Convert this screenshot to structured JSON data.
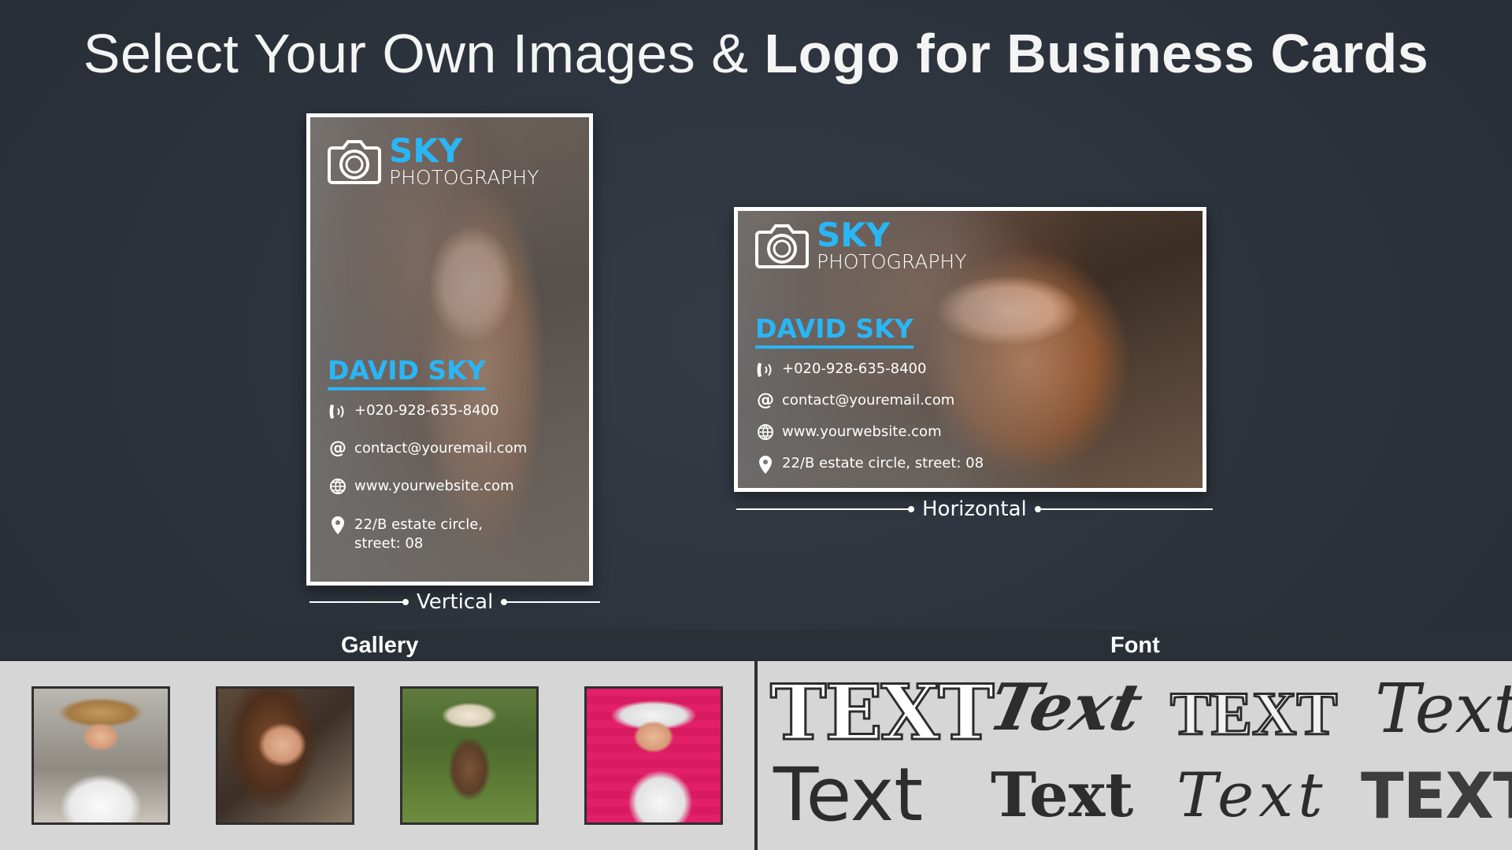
{
  "headline": {
    "light": "Select Your Own Images & ",
    "bold": "Logo for Business Cards"
  },
  "colors": {
    "accent": "#29b6f6",
    "background": "#2c323b",
    "panel": "#d6d6d6",
    "pink": "#e9226b"
  },
  "card": {
    "logo_sky": "SKY",
    "logo_photography": "PHOTOGRAPHY",
    "name": "DAVID SKY",
    "phone": "+020-928-635-8400",
    "email": "contact@youremail.com",
    "website": "www.yourwebsite.com",
    "address": "22/B estate circle, street: 08",
    "address_line1": "22/B estate circle,",
    "address_line2": "street: 08",
    "icons": [
      "camera-icon",
      "phone-icon",
      "at-icon",
      "globe-icon",
      "location-pin-icon"
    ]
  },
  "captions": {
    "vertical": "Vertical",
    "horizontal": "Horizontal"
  },
  "tabs": {
    "gallery": "Gallery",
    "font": "Font"
  },
  "gallery": [
    {
      "name": "woman-straw-hat"
    },
    {
      "name": "woman-portrait"
    },
    {
      "name": "woman-backpack-field"
    },
    {
      "name": "woman-sunglasses-pink"
    }
  ],
  "fonts": [
    "TEXT",
    "Text",
    "TEXT",
    "Text",
    "Text",
    "Text",
    "Text",
    "TEXT"
  ]
}
